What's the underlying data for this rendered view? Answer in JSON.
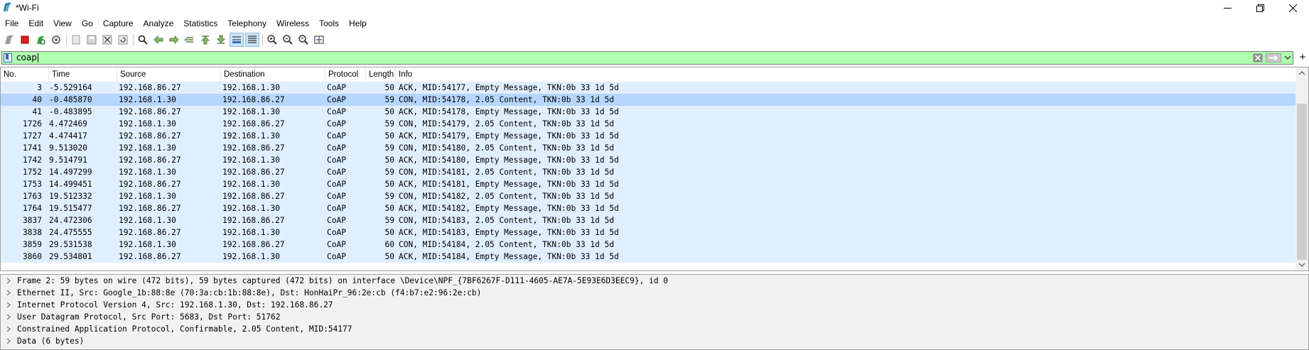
{
  "window": {
    "title": "*Wi-Fi",
    "icon": "wireshark-fin-icon"
  },
  "menu": [
    "File",
    "Edit",
    "View",
    "Go",
    "Capture",
    "Analyze",
    "Statistics",
    "Telephony",
    "Wireless",
    "Tools",
    "Help"
  ],
  "toolbar": {
    "buttons": [
      "start-capture-icon",
      "stop-capture-icon",
      "restart-capture-icon",
      "capture-options-icon",
      "open-file-icon",
      "save-file-icon",
      "close-file-icon",
      "reload-file-icon",
      "find-packet-icon",
      "go-back-icon",
      "go-forward-icon",
      "go-to-packet-icon",
      "go-first-icon",
      "go-last-icon",
      "auto-scroll-icon",
      "colorize-icon",
      "zoom-in-icon",
      "zoom-out-icon",
      "normal-size-icon",
      "resize-columns-icon"
    ]
  },
  "filter": {
    "value": "coap",
    "background": "#afffaf"
  },
  "packet_list": {
    "columns": [
      "No.",
      "Time",
      "Source",
      "Destination",
      "Protocol",
      "Length",
      "Info"
    ],
    "rows": [
      {
        "no": "3",
        "time": "-5.529164",
        "src": "192.168.86.27",
        "dst": "192.168.1.30",
        "proto": "CoAP",
        "len": "50",
        "info": "ACK, MID:54177, Empty Message, TKN:0b 33 1d 5d"
      },
      {
        "no": "40",
        "time": "-0.485870",
        "src": "192.168.1.30",
        "dst": "192.168.86.27",
        "proto": "CoAP",
        "len": "59",
        "info": "CON, MID:54178, 2.05 Content, TKN:0b 33 1d 5d",
        "selected": true
      },
      {
        "no": "41",
        "time": "-0.483895",
        "src": "192.168.86.27",
        "dst": "192.168.1.30",
        "proto": "CoAP",
        "len": "50",
        "info": "ACK, MID:54178, Empty Message, TKN:0b 33 1d 5d"
      },
      {
        "no": "1726",
        "time": "4.472469",
        "src": "192.168.1.30",
        "dst": "192.168.86.27",
        "proto": "CoAP",
        "len": "59",
        "info": "CON, MID:54179, 2.05 Content, TKN:0b 33 1d 5d"
      },
      {
        "no": "1727",
        "time": "4.474417",
        "src": "192.168.86.27",
        "dst": "192.168.1.30",
        "proto": "CoAP",
        "len": "50",
        "info": "ACK, MID:54179, Empty Message, TKN:0b 33 1d 5d"
      },
      {
        "no": "1741",
        "time": "9.513020",
        "src": "192.168.1.30",
        "dst": "192.168.86.27",
        "proto": "CoAP",
        "len": "59",
        "info": "CON, MID:54180, 2.05 Content, TKN:0b 33 1d 5d"
      },
      {
        "no": "1742",
        "time": "9.514791",
        "src": "192.168.86.27",
        "dst": "192.168.1.30",
        "proto": "CoAP",
        "len": "50",
        "info": "ACK, MID:54180, Empty Message, TKN:0b 33 1d 5d"
      },
      {
        "no": "1752",
        "time": "14.497299",
        "src": "192.168.1.30",
        "dst": "192.168.86.27",
        "proto": "CoAP",
        "len": "59",
        "info": "CON, MID:54181, 2.05 Content, TKN:0b 33 1d 5d"
      },
      {
        "no": "1753",
        "time": "14.499451",
        "src": "192.168.86.27",
        "dst": "192.168.1.30",
        "proto": "CoAP",
        "len": "50",
        "info": "ACK, MID:54181, Empty Message, TKN:0b 33 1d 5d"
      },
      {
        "no": "1763",
        "time": "19.512332",
        "src": "192.168.1.30",
        "dst": "192.168.86.27",
        "proto": "CoAP",
        "len": "59",
        "info": "CON, MID:54182, 2.05 Content, TKN:0b 33 1d 5d"
      },
      {
        "no": "1764",
        "time": "19.515477",
        "src": "192.168.86.27",
        "dst": "192.168.1.30",
        "proto": "CoAP",
        "len": "50",
        "info": "ACK, MID:54182, Empty Message, TKN:0b 33 1d 5d"
      },
      {
        "no": "3837",
        "time": "24.472306",
        "src": "192.168.1.30",
        "dst": "192.168.86.27",
        "proto": "CoAP",
        "len": "59",
        "info": "CON, MID:54183, 2.05 Content, TKN:0b 33 1d 5d"
      },
      {
        "no": "3838",
        "time": "24.475555",
        "src": "192.168.86.27",
        "dst": "192.168.1.30",
        "proto": "CoAP",
        "len": "50",
        "info": "ACK, MID:54183, Empty Message, TKN:0b 33 1d 5d"
      },
      {
        "no": "3859",
        "time": "29.531538",
        "src": "192.168.1.30",
        "dst": "192.168.86.27",
        "proto": "CoAP",
        "len": "60",
        "info": "CON, MID:54184, 2.05 Content, TKN:0b 33 1d 5d"
      },
      {
        "no": "3860",
        "time": "29.534801",
        "src": "192.168.86.27",
        "dst": "192.168.1.30",
        "proto": "CoAP",
        "len": "50",
        "info": "ACK, MID:54184, Empty Message, TKN:0b 33 1d 5d"
      }
    ],
    "row_color": "#e0efff",
    "selected_color": "#b5d6ff"
  },
  "details": [
    "Frame 2: 59 bytes on wire (472 bits), 59 bytes captured (472 bits) on interface \\Device\\NPF_{7BF6267F-D111-4605-AE7A-5E93E6D3EEC9}, id 0",
    "Ethernet II, Src: Google_1b:88:8e (70:3a:cb:1b:88:8e), Dst: HonHaiPr_96:2e:cb (f4:b7:e2:96:2e:cb)",
    "Internet Protocol Version 4, Src: 192.168.1.30, Dst: 192.168.86.27",
    "User Datagram Protocol, Src Port: 5683, Dst Port: 51762",
    "Constrained Application Protocol, Confirmable, 2.05 Content, MID:54177",
    "Data (6 bytes)"
  ]
}
